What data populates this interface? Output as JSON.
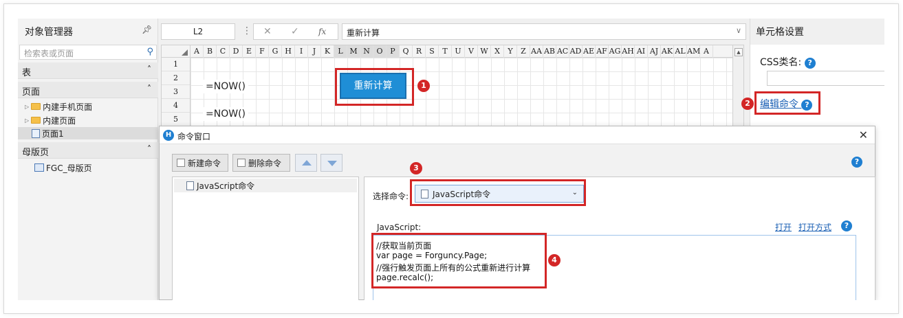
{
  "object_manager": {
    "title": "对象管理器",
    "search_placeholder": "检索表或页面",
    "sections": {
      "tables": "表",
      "pages": "页面",
      "masters": "母版页"
    },
    "page_items": [
      "内建手机页面",
      "内建页面",
      "页面1"
    ],
    "master_items": [
      "FGC_母版页"
    ]
  },
  "toolbar": {
    "cell_ref": "L2",
    "formula": "重新计算",
    "icons": [
      "cancel-icon",
      "confirm-icon",
      "function-icon"
    ]
  },
  "grid": {
    "columns": [
      "A",
      "B",
      "C",
      "D",
      "E",
      "F",
      "G",
      "H",
      "I",
      "J",
      "K",
      "L",
      "M",
      "N",
      "O",
      "P",
      "Q",
      "R",
      "S",
      "T",
      "U",
      "V",
      "W",
      "X",
      "Y",
      "Z",
      "AA",
      "AB",
      "AC",
      "AD",
      "AE",
      "AF",
      "AG",
      "AH",
      "AI",
      "AJ",
      "AK",
      "AL",
      "AM",
      "A"
    ],
    "rows": [
      "1",
      "2",
      "3",
      "4",
      "5"
    ],
    "cell1": "=NOW()",
    "cell2": "=NOW()",
    "button_label": "重新计算"
  },
  "cell_settings": {
    "title": "单元格设置",
    "css_label": "CSS类名:",
    "edit_command": "编辑命令"
  },
  "dialog": {
    "title": "命令窗口",
    "new_command": "新建命令",
    "delete_command": "删除命令",
    "commands": [
      "JavaScript命令"
    ],
    "select_label": "选择命令:",
    "selected_command": "JavaScript命令",
    "js_label": "JavaScript:",
    "open_link": "打开",
    "open_with_link": "打开方式",
    "code": [
      "//获取当前页面",
      "var page = Forguncy.Page;",
      "//强行触发页面上所有的公式重新进行计算",
      "page.recalc();"
    ]
  },
  "badges": [
    "1",
    "2",
    "3",
    "4"
  ],
  "colors": {
    "accent": "#1f8ed6",
    "highlight": "#d32626",
    "link": "#1a5fb4"
  }
}
